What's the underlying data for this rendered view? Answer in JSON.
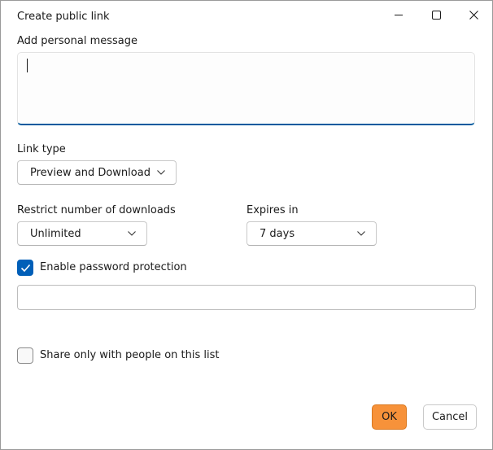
{
  "window": {
    "title": "Create public link"
  },
  "message": {
    "label": "Add personal message",
    "value": ""
  },
  "link_type": {
    "label": "Link type",
    "selected": "Preview and Download"
  },
  "downloads": {
    "label": "Restrict number of downloads",
    "selected": "Unlimited"
  },
  "expires": {
    "label": "Expires in",
    "selected": "7 days"
  },
  "password": {
    "checkbox_label": "Enable password protection",
    "checked": true,
    "value": ""
  },
  "share_list": {
    "checkbox_label": "Share only with people on this list",
    "checked": false
  },
  "buttons": {
    "ok": "OK",
    "cancel": "Cancel"
  },
  "colors": {
    "accent": "#005fb8",
    "ok_button": "#f7923a"
  },
  "icons": {
    "minimize": "minimize-icon",
    "maximize": "maximize-icon",
    "close": "close-icon",
    "chevron": "chevron-down-icon",
    "check": "checkmark-icon"
  }
}
